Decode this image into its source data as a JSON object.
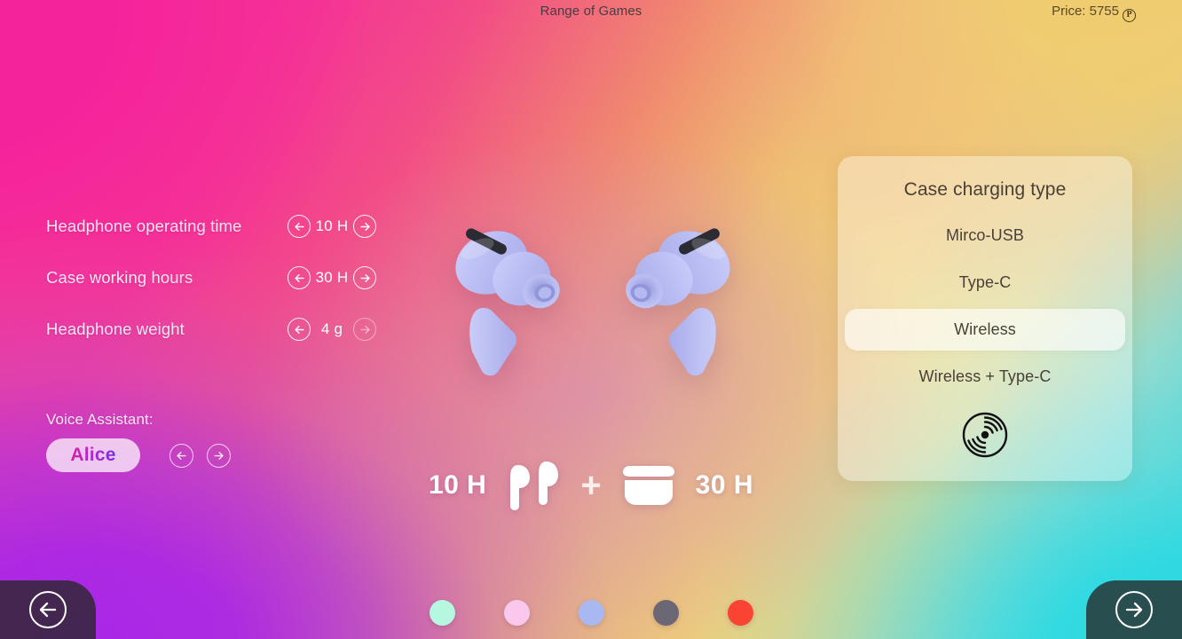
{
  "topbar": {
    "title": "Range of Games",
    "price_label": "Price: 5755",
    "currency_symbol": "₽",
    "currency_glyph": "P"
  },
  "specs": {
    "rows": [
      {
        "label": "Headphone operating time",
        "value": "10 H",
        "prev_enabled": true,
        "next_enabled": true
      },
      {
        "label": "Case working hours",
        "value": "30 H",
        "prev_enabled": true,
        "next_enabled": true
      },
      {
        "label": "Headphone weight",
        "value": "4 g",
        "prev_enabled": true,
        "next_enabled": false
      }
    ]
  },
  "voice_assistant": {
    "label": "Voice Assistant:",
    "value": "Alice",
    "prev_icon": "arrow-left-icon",
    "next_icon": "arrow-right-icon"
  },
  "product": {
    "image_name": "wireless-earbuds-illustration",
    "color": "#b9bcf2"
  },
  "summary": {
    "earbuds_hours": "10 H",
    "plus": "+",
    "case_hours": "30 H",
    "earbuds_icon": "earbuds-icon",
    "case_icon": "charging-case-icon"
  },
  "charging_panel": {
    "title": "Case charging type",
    "options": [
      {
        "label": "Mirco-USB",
        "selected": false
      },
      {
        "label": "Type-C",
        "selected": false
      },
      {
        "label": "Wireless",
        "selected": true
      },
      {
        "label": "Wireless + Type-C",
        "selected": false
      }
    ],
    "footer_icon": "wireless-charging-icon"
  },
  "color_swatches": [
    {
      "name": "mint",
      "hex": "#b6f7e0"
    },
    {
      "name": "pink",
      "hex": "#f9c8ec"
    },
    {
      "name": "periwinkle",
      "hex": "#aab8f2"
    },
    {
      "name": "graphite",
      "hex": "#6b6775"
    },
    {
      "name": "red",
      "hex": "#fb4334"
    }
  ],
  "navigation": {
    "prev_icon": "arrow-left-icon",
    "next_icon": "arrow-right-icon"
  },
  "theme": {
    "bg_top_left": "#f5239b",
    "bg_top_right": "#f0cc70",
    "bg_bottom_left": "#a828e8",
    "bg_bottom_right": "#2dd9e2",
    "text_light": "#ffffff",
    "panel_text": "#4a4038"
  }
}
